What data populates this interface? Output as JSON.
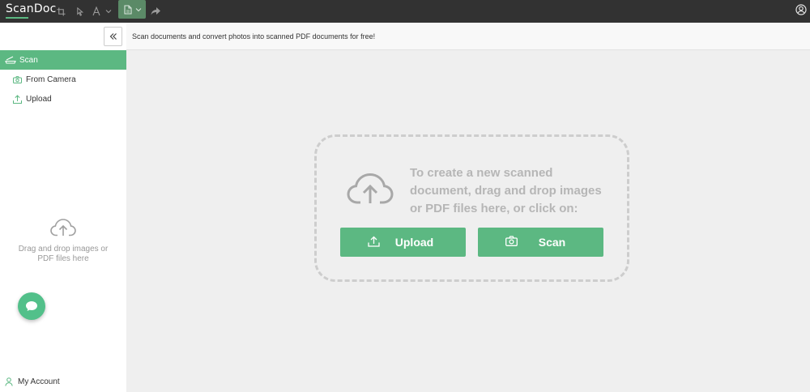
{
  "app": {
    "title": "ScanDoc"
  },
  "topbar": {
    "icons": [
      "crop-icon",
      "cursor-icon",
      "text-tool-icon",
      "document-icon",
      "redo-icon",
      "account-icon"
    ]
  },
  "sidebar": {
    "nav": {
      "scan": "Scan",
      "from_camera": "From Camera",
      "upload": "Upload"
    },
    "drop_text": "Drag and drop images or PDF files here",
    "my_account": "My Account"
  },
  "infobar": {
    "text": "Scan documents and convert photos into scanned PDF documents for free!"
  },
  "dropzone": {
    "text": "To create a new scanned document, drag and drop images or PDF files here, or click on:",
    "upload_label": "Upload",
    "scan_label": "Scan"
  },
  "colors": {
    "accent": "#5cb882",
    "topbar": "#323232",
    "background": "#efefef"
  }
}
